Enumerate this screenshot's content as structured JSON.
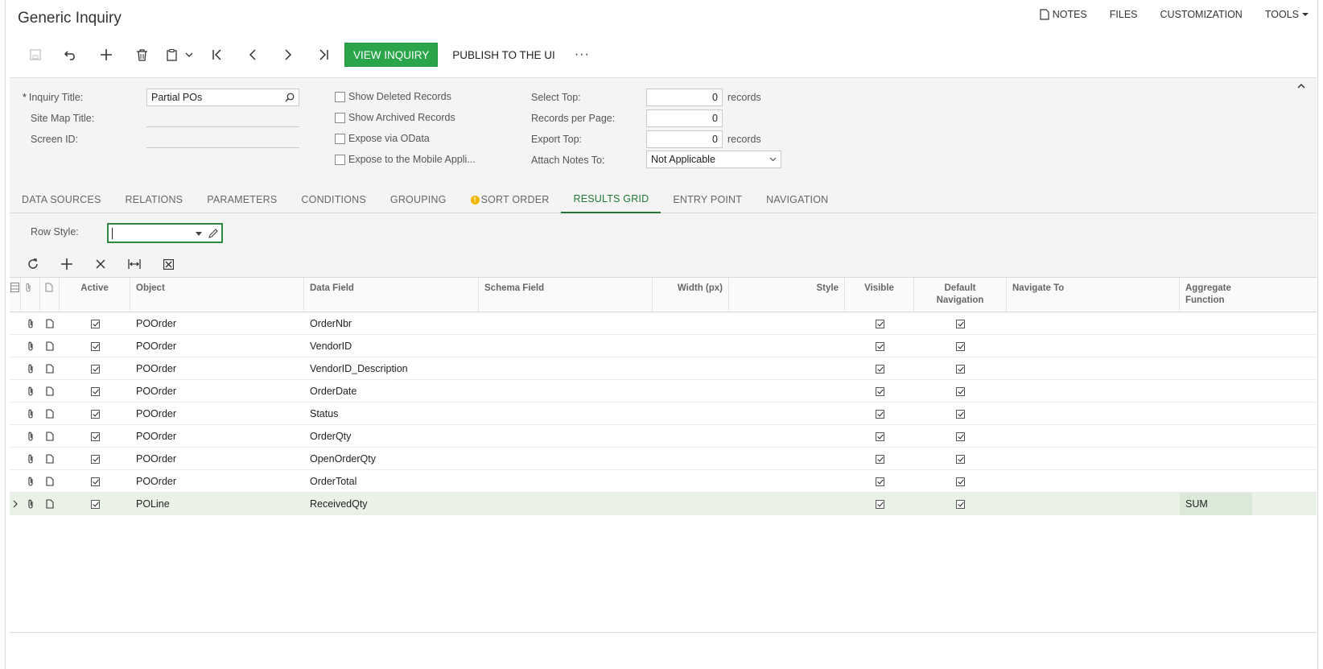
{
  "page": {
    "title": "Generic Inquiry"
  },
  "top_links": {
    "notes": "NOTES",
    "files": "FILES",
    "customization": "CUSTOMIZATION",
    "tools": "TOOLS"
  },
  "toolbar": {
    "view_inquiry": "VIEW INQUIRY",
    "publish": "PUBLISH TO THE UI",
    "more": "···"
  },
  "form": {
    "inquiry_title_label": "Inquiry Title:",
    "inquiry_title_value": "Partial POs",
    "required_mark": "*",
    "site_map_title_label": "Site Map Title:",
    "screen_id_label": "Screen ID:",
    "show_deleted": "Show Deleted Records",
    "show_archived": "Show Archived Records",
    "expose_odata": "Expose via OData",
    "expose_mobile": "Expose to the Mobile Appli...",
    "select_top_label": "Select Top:",
    "select_top_value": "0",
    "records_per_page_label": "Records per Page:",
    "records_per_page_value": "0",
    "export_top_label": "Export Top:",
    "export_top_value": "0",
    "records_unit": "records",
    "attach_notes_label": "Attach Notes To:",
    "attach_notes_value": "Not Applicable"
  },
  "tabs": [
    "DATA SOURCES",
    "RELATIONS",
    "PARAMETERS",
    "CONDITIONS",
    "GROUPING",
    "SORT ORDER",
    "RESULTS GRID",
    "ENTRY POINT",
    "NAVIGATION"
  ],
  "warning_mark": "!",
  "row_style": {
    "label": "Row Style:"
  },
  "grid": {
    "headers": {
      "active": "Active",
      "object": "Object",
      "data_field": "Data Field",
      "schema_field": "Schema Field",
      "width": "Width (px)",
      "style": "Style",
      "visible": "Visible",
      "default_nav": "Default Navigation",
      "navigate_to": "Navigate To",
      "aggregate": "Aggregate Function"
    },
    "rows": [
      {
        "object": "POOrder",
        "data_field": "OrderNbr",
        "aggregate": ""
      },
      {
        "object": "POOrder",
        "data_field": "VendorID",
        "aggregate": ""
      },
      {
        "object": "POOrder",
        "data_field": "VendorID_Description",
        "aggregate": ""
      },
      {
        "object": "POOrder",
        "data_field": "OrderDate",
        "aggregate": ""
      },
      {
        "object": "POOrder",
        "data_field": "Status",
        "aggregate": ""
      },
      {
        "object": "POOrder",
        "data_field": "OrderQty",
        "aggregate": ""
      },
      {
        "object": "POOrder",
        "data_field": "OpenOrderQty",
        "aggregate": ""
      },
      {
        "object": "POOrder",
        "data_field": "OrderTotal",
        "aggregate": ""
      },
      {
        "object": "POLine",
        "data_field": "ReceivedQty",
        "aggregate": "SUM"
      }
    ]
  }
}
